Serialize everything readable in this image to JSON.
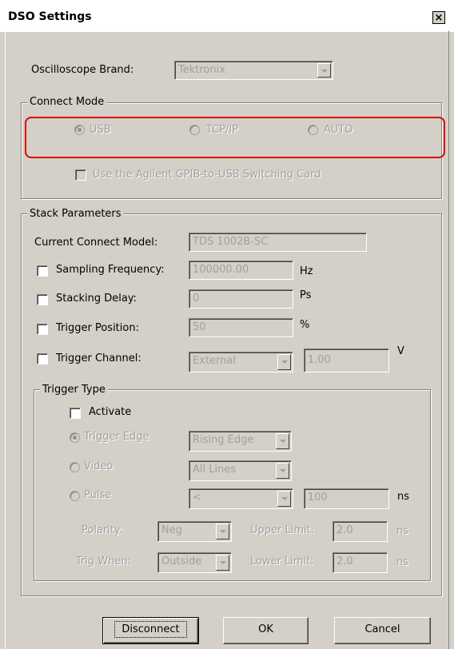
{
  "window": {
    "title": "DSO Settings",
    "close_glyph": "×"
  },
  "brand": {
    "label": "Oscilloscope Brand:",
    "value": "Tektronix"
  },
  "connect_mode": {
    "legend": "Connect Mode",
    "usb": "USB",
    "tcpip": "TCP/IP",
    "auto": "AUTO",
    "agilent_checkbox": "Use the Agilent GPIB-to-USB Switching Card",
    "highlight_color": "#e00000"
  },
  "stack": {
    "legend": "Stack Parameters",
    "current_model_label": "Current Connect Model:",
    "current_model_value": "TDS 1002B-SC",
    "sampling_label": "Sampling Frequency:",
    "sampling_value": "100000.00",
    "sampling_unit": "Hz",
    "delay_label": "Stacking Delay:",
    "delay_value": "0",
    "delay_unit": "Ps",
    "position_label": "Trigger Position:",
    "position_value": "50",
    "position_unit": "%",
    "channel_label": "Trigger Channel:",
    "channel_value": "External",
    "channel_level": "1.00",
    "channel_unit": "V"
  },
  "trigger_type": {
    "legend": "Trigger Type",
    "activate": "Activate",
    "edge_label": "Trigger Edge",
    "edge_value": "Rising Edge",
    "video_label": "Video",
    "video_value": "All Lines",
    "pulse_label": "Pulse",
    "pulse_value": "<",
    "pulse_width": "100",
    "pulse_unit": "ns",
    "polarity_label": "Polarity:",
    "polarity_value": "Neg",
    "upper_label": "Upper Limit:",
    "upper_value": "2.0",
    "upper_unit": "ns",
    "trig_when_label": "Trig When:",
    "trig_when_value": "Outside",
    "lower_label": "Lower Limit:",
    "lower_value": "2.0",
    "lower_unit": "ns"
  },
  "buttons": {
    "disconnect": "Disconnect",
    "ok": "OK",
    "cancel": "Cancel"
  }
}
